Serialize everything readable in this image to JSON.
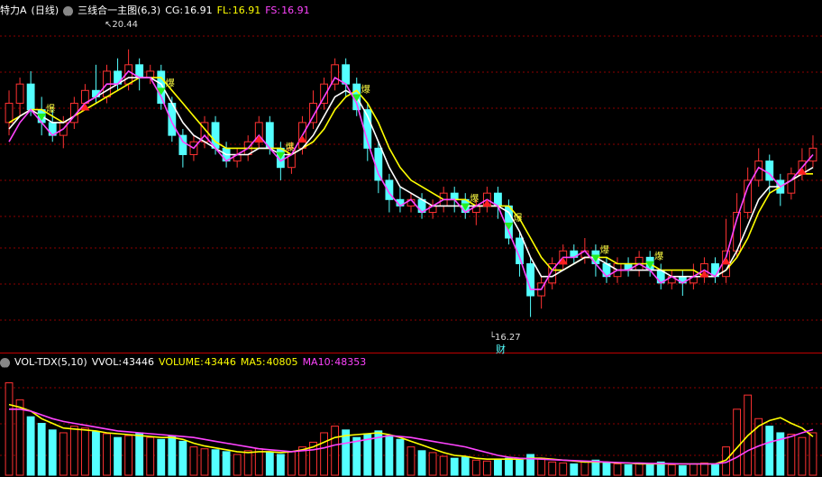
{
  "header_main": {
    "stock_name": "特力A",
    "period": "(日线)",
    "indicator": "三线合一主图(6,3)",
    "cg_label": "CG:",
    "cg_value": "16.91",
    "fl_label": "FL:",
    "fl_value": "16.91",
    "fs_label": "FS:",
    "fs_value": "16.91",
    "colors": {
      "name": "#ffffff",
      "indicator": "#ffffff",
      "cg": "#ffffff",
      "fl": "#ffff00",
      "fs": "#ff44ff"
    }
  },
  "header_vol": {
    "indicator": "VOL-TDX(5,10)",
    "vvol_label": "VVOL:",
    "vvol_value": "43446",
    "volume_label": "VOLUME:",
    "volume_value": "43446",
    "ma5_label": "MA5:",
    "ma5_value": "40805",
    "ma10_label": "MA10:",
    "ma10_value": "48353",
    "colors": {
      "vvol": "#ffffff",
      "volume": "#ffff00",
      "ma5": "#ffff00",
      "ma10": "#ff44ff"
    }
  },
  "annotations": {
    "high": "20.44",
    "low": "16.27",
    "cai_mark": "财",
    "signal_mark": "爆"
  },
  "chart_data": [
    {
      "type": "candlestick",
      "title": "",
      "ylim": [
        15.8,
        20.9
      ],
      "up_color": "#ff3232",
      "down_color": "#54ffff",
      "line_colors": {
        "cg": "#ffffff",
        "fl": "#ffff00",
        "fs": "#ff44ff"
      },
      "candles": [
        [
          19.3,
          19.6,
          19.8,
          19.1
        ],
        [
          19.6,
          19.9,
          20.0,
          19.4
        ],
        [
          19.9,
          19.5,
          20.1,
          19.4
        ],
        [
          19.5,
          19.3,
          19.7,
          19.1
        ],
        [
          19.3,
          19.1,
          19.5,
          19.0
        ],
        [
          19.1,
          19.3,
          19.4,
          18.9
        ],
        [
          19.3,
          19.6,
          19.7,
          19.2
        ],
        [
          19.6,
          19.8,
          19.9,
          19.5
        ],
        [
          19.8,
          19.7,
          20.2,
          19.6
        ],
        [
          19.7,
          20.1,
          20.2,
          19.6
        ],
        [
          20.1,
          19.9,
          20.3,
          19.8
        ],
        [
          19.9,
          20.2,
          20.44,
          19.8
        ],
        [
          20.2,
          20.0,
          20.3,
          19.8
        ],
        [
          20.0,
          20.1,
          20.2,
          19.9
        ],
        [
          20.1,
          19.6,
          20.2,
          19.5
        ],
        [
          19.6,
          19.1,
          19.7,
          19.0
        ],
        [
          19.1,
          18.8,
          19.2,
          18.6
        ],
        [
          18.8,
          19.0,
          19.1,
          18.7
        ],
        [
          19.0,
          19.3,
          19.4,
          18.9
        ],
        [
          19.3,
          18.9,
          19.4,
          18.8
        ],
        [
          18.9,
          18.7,
          19.0,
          18.6
        ],
        [
          18.7,
          18.8,
          18.9,
          18.6
        ],
        [
          18.8,
          19.0,
          19.1,
          18.7
        ],
        [
          19.0,
          19.3,
          19.4,
          18.9
        ],
        [
          19.3,
          18.9,
          19.4,
          18.8
        ],
        [
          18.9,
          18.6,
          19.0,
          18.4
        ],
        [
          18.6,
          18.9,
          19.0,
          18.5
        ],
        [
          18.9,
          19.3,
          19.4,
          18.8
        ],
        [
          19.3,
          19.6,
          19.8,
          19.2
        ],
        [
          19.6,
          19.9,
          20.0,
          19.5
        ],
        [
          19.9,
          20.2,
          20.3,
          19.8
        ],
        [
          20.2,
          19.9,
          20.3,
          19.7
        ],
        [
          19.9,
          19.5,
          20.0,
          19.4
        ],
        [
          19.5,
          18.9,
          19.6,
          18.7
        ],
        [
          18.9,
          18.4,
          19.0,
          18.2
        ],
        [
          18.4,
          18.1,
          18.5,
          17.9
        ],
        [
          18.1,
          18.0,
          18.3,
          17.9
        ],
        [
          18.0,
          18.1,
          18.2,
          17.9
        ],
        [
          18.1,
          17.9,
          18.2,
          17.8
        ],
        [
          17.9,
          18.0,
          18.1,
          17.8
        ],
        [
          18.0,
          18.2,
          18.3,
          17.9
        ],
        [
          18.2,
          18.1,
          18.3,
          17.9
        ],
        [
          18.1,
          17.9,
          18.2,
          17.8
        ],
        [
          17.9,
          18.0,
          18.1,
          17.7
        ],
        [
          18.0,
          18.2,
          18.3,
          17.9
        ],
        [
          18.2,
          18.0,
          18.3,
          17.8
        ],
        [
          18.0,
          17.5,
          18.1,
          17.4
        ],
        [
          17.5,
          17.1,
          17.6,
          16.9
        ],
        [
          17.1,
          16.6,
          17.2,
          16.27
        ],
        [
          16.6,
          16.8,
          16.9,
          16.4
        ],
        [
          16.8,
          17.1,
          17.2,
          16.7
        ],
        [
          17.1,
          17.3,
          17.4,
          17.0
        ],
        [
          17.3,
          17.2,
          17.4,
          17.1
        ],
        [
          17.2,
          17.3,
          17.5,
          17.1
        ],
        [
          17.3,
          17.1,
          17.4,
          16.9
        ],
        [
          17.1,
          16.9,
          17.2,
          16.8
        ],
        [
          16.9,
          17.1,
          17.2,
          16.8
        ],
        [
          17.1,
          17.0,
          17.2,
          16.9
        ],
        [
          17.0,
          17.2,
          17.3,
          16.9
        ],
        [
          17.2,
          17.0,
          17.3,
          16.9
        ],
        [
          17.0,
          16.8,
          17.1,
          16.7
        ],
        [
          16.8,
          16.9,
          17.0,
          16.7
        ],
        [
          16.9,
          16.8,
          17.0,
          16.6
        ],
        [
          16.8,
          16.9,
          17.1,
          16.7
        ],
        [
          16.9,
          17.1,
          17.2,
          16.8
        ],
        [
          17.1,
          16.9,
          17.2,
          16.8
        ],
        [
          16.9,
          17.3,
          17.8,
          16.8
        ],
        [
          17.3,
          17.9,
          18.2,
          17.2
        ],
        [
          17.9,
          18.4,
          18.6,
          17.8
        ],
        [
          18.4,
          18.7,
          18.9,
          18.3
        ],
        [
          18.7,
          18.4,
          18.8,
          18.2
        ],
        [
          18.4,
          18.2,
          18.5,
          18.0
        ],
        [
          18.2,
          18.5,
          18.6,
          18.1
        ],
        [
          18.5,
          18.7,
          18.9,
          18.4
        ],
        [
          18.7,
          18.9,
          19.1,
          18.6
        ]
      ],
      "cg": [
        19.2,
        19.4,
        19.5,
        19.4,
        19.3,
        19.3,
        19.4,
        19.6,
        19.7,
        19.8,
        19.9,
        20.0,
        20.0,
        20.0,
        19.9,
        19.6,
        19.3,
        19.1,
        19.0,
        18.9,
        18.8,
        18.8,
        18.8,
        18.9,
        18.9,
        18.8,
        18.8,
        18.9,
        19.1,
        19.4,
        19.7,
        19.8,
        19.7,
        19.4,
        19.0,
        18.6,
        18.3,
        18.2,
        18.1,
        18.0,
        18.0,
        18.0,
        18.0,
        18.0,
        18.0,
        18.0,
        17.9,
        17.6,
        17.2,
        16.9,
        16.9,
        17.0,
        17.1,
        17.2,
        17.2,
        17.1,
        17.0,
        17.0,
        17.0,
        17.0,
        17.0,
        16.9,
        16.9,
        16.9,
        16.9,
        16.9,
        17.0,
        17.3,
        17.7,
        18.1,
        18.3,
        18.3,
        18.4,
        18.5,
        18.6
      ],
      "fl": [
        19.3,
        19.4,
        19.5,
        19.5,
        19.4,
        19.3,
        19.4,
        19.5,
        19.6,
        19.7,
        19.8,
        19.9,
        20.0,
        20.0,
        20.0,
        19.8,
        19.6,
        19.4,
        19.2,
        19.0,
        18.9,
        18.9,
        18.9,
        18.9,
        18.9,
        18.9,
        18.8,
        18.9,
        19.0,
        19.2,
        19.5,
        19.7,
        19.8,
        19.6,
        19.3,
        18.9,
        18.6,
        18.4,
        18.3,
        18.2,
        18.1,
        18.1,
        18.1,
        18.0,
        18.0,
        18.0,
        18.0,
        17.8,
        17.5,
        17.2,
        17.0,
        17.0,
        17.1,
        17.2,
        17.2,
        17.2,
        17.1,
        17.1,
        17.1,
        17.1,
        17.0,
        17.0,
        17.0,
        17.0,
        16.9,
        16.9,
        17.0,
        17.2,
        17.5,
        17.9,
        18.2,
        18.3,
        18.4,
        18.5,
        18.5
      ],
      "fs": [
        19.0,
        19.3,
        19.5,
        19.3,
        19.1,
        19.2,
        19.4,
        19.6,
        19.7,
        19.9,
        19.9,
        20.1,
        20.0,
        20.0,
        19.7,
        19.3,
        19.0,
        18.9,
        19.1,
        18.9,
        18.7,
        18.8,
        18.9,
        19.1,
        18.9,
        18.7,
        18.8,
        19.1,
        19.4,
        19.7,
        20.0,
        19.9,
        19.6,
        19.0,
        18.5,
        18.2,
        18.0,
        18.1,
        17.9,
        18.0,
        18.1,
        18.1,
        17.9,
        18.0,
        18.1,
        18.0,
        17.6,
        17.2,
        16.7,
        16.7,
        17.0,
        17.2,
        17.2,
        17.3,
        17.1,
        16.9,
        17.0,
        17.0,
        17.1,
        17.0,
        16.8,
        16.9,
        16.8,
        16.9,
        17.0,
        16.9,
        17.2,
        17.8,
        18.3,
        18.6,
        18.5,
        18.3,
        18.4,
        18.6,
        18.8
      ]
    },
    {
      "type": "bar",
      "title": "",
      "ylim": [
        0,
        110000
      ],
      "up_color": "#ff3232",
      "down_color": "#54ffff",
      "line_colors": {
        "ma5": "#ffff00",
        "ma10": "#ff44ff"
      },
      "values": [
        98000,
        80000,
        62000,
        55000,
        48000,
        45000,
        52000,
        50000,
        46000,
        44000,
        40000,
        42000,
        45000,
        40000,
        38000,
        42000,
        36000,
        30000,
        28000,
        27000,
        25000,
        22000,
        26000,
        28000,
        24000,
        22000,
        25000,
        30000,
        35000,
        45000,
        52000,
        48000,
        40000,
        44000,
        47000,
        42000,
        38000,
        30000,
        26000,
        24000,
        20000,
        18000,
        19000,
        16000,
        15000,
        17000,
        18000,
        16000,
        22000,
        18000,
        14000,
        13000,
        12000,
        14000,
        16000,
        13000,
        12000,
        11000,
        13000,
        12000,
        14000,
        11000,
        10000,
        12000,
        13000,
        11000,
        30000,
        70000,
        85000,
        60000,
        52000,
        45000,
        43446,
        40000,
        45000
      ],
      "ma5": [
        75000,
        72000,
        68000,
        60000,
        55000,
        50000,
        49000,
        48000,
        47000,
        45000,
        44000,
        43000,
        42000,
        41000,
        40000,
        40000,
        38000,
        34000,
        31000,
        29000,
        27000,
        25000,
        24000,
        25000,
        25000,
        24000,
        25000,
        27000,
        30000,
        35000,
        40000,
        42000,
        43000,
        44000,
        45000,
        43000,
        40000,
        36000,
        32000,
        28000,
        24000,
        21000,
        20000,
        18000,
        17000,
        17000,
        17000,
        17000,
        18000,
        18000,
        17000,
        16000,
        15000,
        14000,
        14000,
        14000,
        13000,
        13000,
        12000,
        12000,
        12000,
        12000,
        12000,
        12000,
        12000,
        12000,
        16000,
        29000,
        42000,
        52000,
        58000,
        61000,
        55000,
        50000,
        40805
      ],
      "ma10": [
        70000,
        70000,
        68000,
        64000,
        60000,
        57000,
        55000,
        53000,
        51000,
        49000,
        47000,
        46000,
        45000,
        44000,
        43000,
        42000,
        41000,
        40000,
        38000,
        36000,
        34000,
        32000,
        30000,
        28000,
        27000,
        26000,
        25000,
        26000,
        27000,
        29000,
        32000,
        34000,
        36000,
        38000,
        40000,
        42000,
        41000,
        40000,
        38000,
        36000,
        34000,
        32000,
        30000,
        27000,
        24000,
        21000,
        19000,
        18000,
        17500,
        17000,
        16500,
        16000,
        15500,
        15000,
        14500,
        14000,
        13500,
        13000,
        12800,
        12500,
        12300,
        12200,
        12000,
        12000,
        12000,
        12000,
        13500,
        19000,
        26000,
        31000,
        35000,
        38000,
        41000,
        45000,
        48353
      ]
    }
  ]
}
